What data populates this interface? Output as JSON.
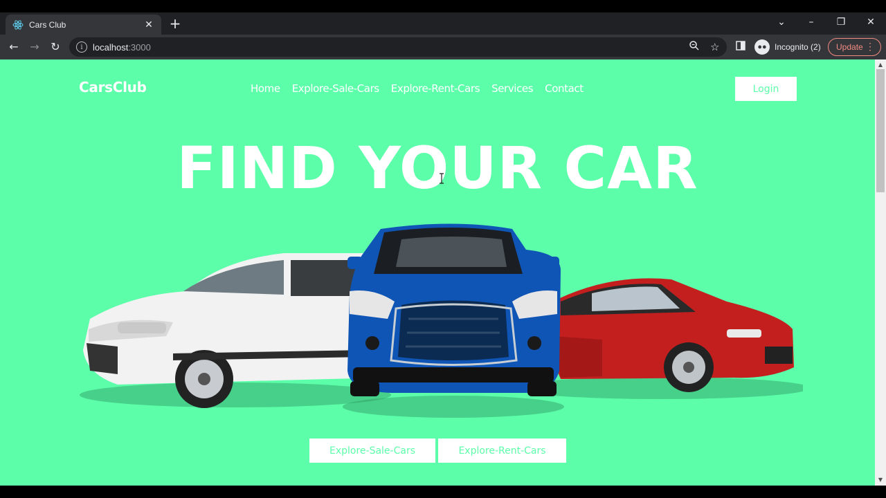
{
  "browser": {
    "tab_title": "Cars Club",
    "url_host": "localhost",
    "url_port": ":3000",
    "profile_label": "Incognito (2)",
    "update_label": "Update"
  },
  "site": {
    "logo": "CarsClub",
    "nav": [
      "Home",
      "Explore-Sale-Cars",
      "Explore-Rent-Cars",
      "Services",
      "Contact"
    ],
    "login_label": "Login",
    "hero_title": "FIND YOUR CAR",
    "cta_sale": "Explore-Sale-Cars",
    "cta_rent": "Explore-Rent-Cars"
  },
  "colors": {
    "page_bg": "#5cfeaa",
    "accent_text": "#5cfeaa",
    "white": "#ffffff",
    "car_white": "#f2f2f2",
    "car_blue": "#0f55b5",
    "car_red": "#c41f1f"
  },
  "icons": [
    "react-icon",
    "close-icon",
    "plus-icon",
    "back-arrow-icon",
    "forward-arrow-icon",
    "reload-icon",
    "info-icon",
    "zoom-icon",
    "star-icon",
    "sidepanel-icon",
    "incognito-icon",
    "kebab-icon",
    "chevron-down-icon",
    "minimize-icon",
    "restore-icon",
    "window-close-icon"
  ]
}
